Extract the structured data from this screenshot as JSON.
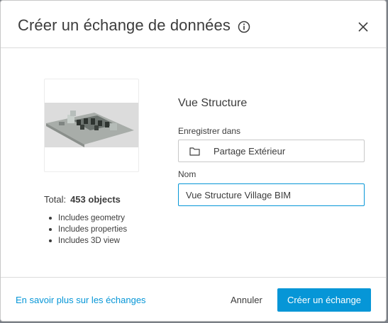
{
  "dialog": {
    "title": "Créer un échange de données",
    "info_icon": "info-icon",
    "close_icon": "close-icon"
  },
  "summary": {
    "total_label": "Total:",
    "total_value": "453 objects",
    "includes": [
      "Includes geometry",
      "Includes properties",
      "Includes 3D view"
    ]
  },
  "form": {
    "view_name": "Vue Structure",
    "folder_label": "Enregistrer dans",
    "folder_value": "Partage Extérieur",
    "folder_icon": "folder-icon",
    "name_label": "Nom",
    "name_value": "Vue Structure Village BIM"
  },
  "footer": {
    "learn_more": "En savoir plus sur les échanges",
    "cancel": "Annuler",
    "create": "Créer un échange"
  },
  "colors": {
    "accent": "#0696d7",
    "text": "#3c3c3c",
    "border": "#c8c8c8"
  }
}
